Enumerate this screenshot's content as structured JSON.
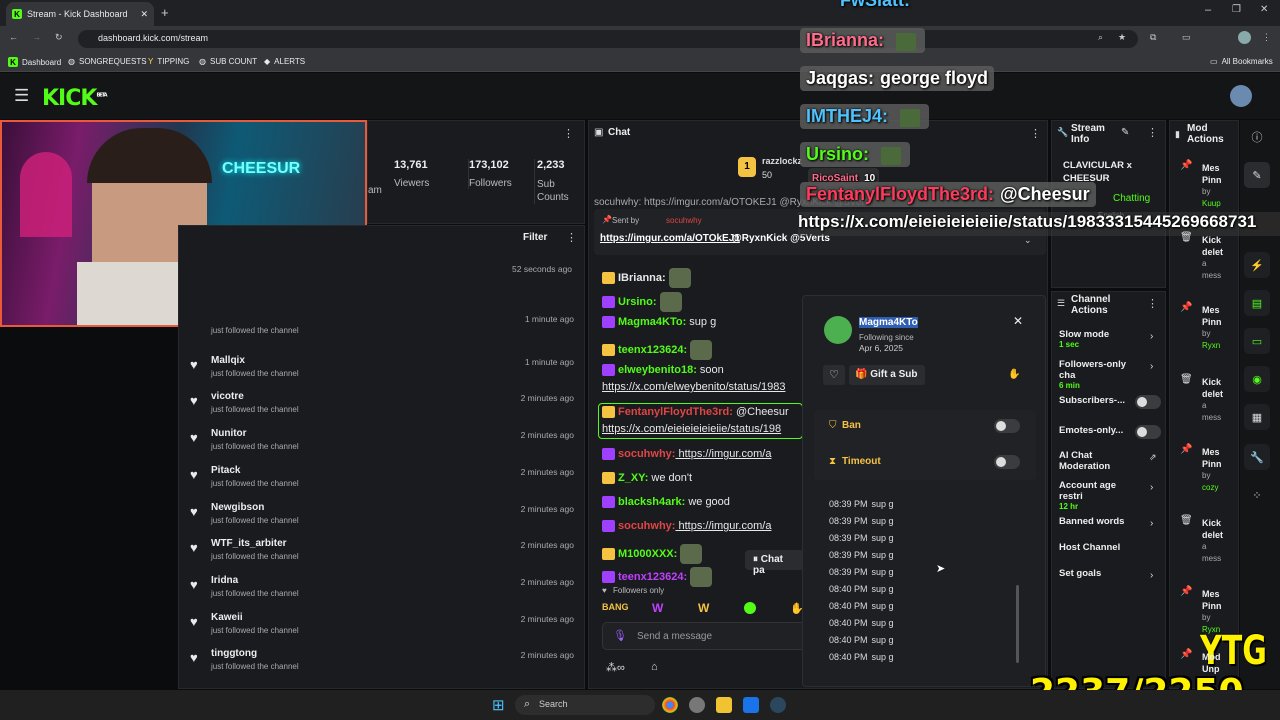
{
  "browser": {
    "tab_title": "Stream - Kick Dashboard",
    "url": "dashboard.kick.com/stream",
    "bookmarks": [
      "Dashboard",
      "SONGREQUESTS",
      "TIPPING",
      "SUB COUNT",
      "ALERTS"
    ],
    "all_bookmarks": "All Bookmarks"
  },
  "kick": {
    "logo": "KICK",
    "logo_tag": "BETA"
  },
  "stats": {
    "items": [
      {
        "value": "13,761",
        "label": "Viewers"
      },
      {
        "value": "173,102",
        "label": "Followers"
      },
      {
        "value": "2,233",
        "label": "Sub Counts"
      }
    ],
    "partial_label": "am"
  },
  "activity": {
    "filter": "Filter",
    "first_ago": "52 seconds ago",
    "items": [
      {
        "name": "",
        "sub": "just followed the channel",
        "ago": "1 minute ago"
      },
      {
        "name": "Mallqix",
        "sub": "just followed the channel",
        "ago": "1 minute ago"
      },
      {
        "name": "vicotre",
        "sub": "just followed the channel",
        "ago": "2 minutes ago"
      },
      {
        "name": "Nunitor",
        "sub": "just followed the channel",
        "ago": "2 minutes ago"
      },
      {
        "name": "Pitack",
        "sub": "just followed the channel",
        "ago": "2 minutes ago"
      },
      {
        "name": "Newgibson",
        "sub": "just followed the channel",
        "ago": "2 minutes ago"
      },
      {
        "name": "WTF_its_arbiter",
        "sub": "just followed the channel",
        "ago": "2 minutes ago"
      },
      {
        "name": "Iridna",
        "sub": "just followed the channel",
        "ago": "2 minutes ago"
      },
      {
        "name": "Kaweii",
        "sub": "just followed the channel",
        "ago": "2 minutes ago"
      },
      {
        "name": "tinggtong",
        "sub": "just followed the channel",
        "ago": "2 minutes ago"
      }
    ]
  },
  "chat": {
    "title": "Chat",
    "pinned_user": "razzlockz",
    "pinned_count": "50",
    "sender_line": "Sent by",
    "sender_name": "socuhwhy",
    "pinned_link": "https://imgur.com/a/OTOkEJ1",
    "pinned_mentions": " @RyxnKick @5Verts",
    "top_partial": "socuhwhy: https://imgur.com/a/OTOKEJ1 @RyxnKick @5Verts",
    "messages": [
      {
        "user": "IBrianna:",
        "text": ""
      },
      {
        "user": "Ursino:",
        "text": ""
      },
      {
        "user": "Magma4KTo:",
        "text": " sup g"
      },
      {
        "user": "teenx123624:",
        "text": ""
      },
      {
        "user": "elweybenito18:",
        "text": " soon"
      },
      {
        "user": "",
        "text": "https://x.com/elweybenito/status/1983"
      },
      {
        "user": "FentanylFloydThe3rd:",
        "text": " @Cheesur"
      },
      {
        "user": "",
        "text": "https://x.com/eieieieieieiie/status/198"
      },
      {
        "user": "socuhwhy:",
        "text": " https://imgur.com/a"
      },
      {
        "user": "Z_XY:",
        "text": " we don't"
      },
      {
        "user": "blacksh4ark:",
        "text": " we good"
      },
      {
        "user": "socuhwhy:",
        "text": " https://imgur.com/a"
      },
      {
        "user": "M1000XXX:",
        "text": ""
      },
      {
        "user": "teenx123624:",
        "text": ""
      }
    ],
    "followers_only": "Followers only",
    "paused": "Chat pa",
    "send_placeholder": "Send a message"
  },
  "usercard": {
    "name": "Magma4KTo",
    "following": "Following since",
    "date": "Apr 6, 2025",
    "gift": "Gift a Sub",
    "ban": "Ban",
    "timeout": "Timeout",
    "log": [
      {
        "time": "08:39 PM",
        "msg": "sup g"
      },
      {
        "time": "08:39 PM",
        "msg": "sup g"
      },
      {
        "time": "08:39 PM",
        "msg": "sup g"
      },
      {
        "time": "08:39 PM",
        "msg": "sup g"
      },
      {
        "time": "08:39 PM",
        "msg": "sup g"
      },
      {
        "time": "08:40 PM",
        "msg": "sup g"
      },
      {
        "time": "08:40 PM",
        "msg": "sup g"
      },
      {
        "time": "08:40 PM",
        "msg": "sup g"
      },
      {
        "time": "08:40 PM",
        "msg": "sup g"
      },
      {
        "time": "08:40 PM",
        "msg": "sup g"
      }
    ]
  },
  "streaminfo": {
    "title": "Stream Info",
    "stream_title": "CLAVICULAR x CHEESUR",
    "category": "Chatting",
    "language": "English"
  },
  "channel": {
    "title": "Channel Actions",
    "items": [
      {
        "label": "Slow mode",
        "sub": "1 sec"
      },
      {
        "label": "Followers-only cha",
        "sub": "6 min"
      },
      {
        "label": "Subscribers-...",
        "sub": ""
      },
      {
        "label": "Emotes-only...",
        "sub": ""
      },
      {
        "label": "AI Chat Moderation",
        "sub": ""
      },
      {
        "label": "Account age restri",
        "sub": "12 hr"
      },
      {
        "label": "Banned words",
        "sub": ""
      },
      {
        "label": "Host Channel",
        "sub": ""
      },
      {
        "label": "Set goals",
        "sub": ""
      }
    ]
  },
  "mod": {
    "title": "Mod Actions",
    "items": [
      {
        "line1": "Mes",
        "line2": "Pinn",
        "line3": "by",
        "line4": "Kuup"
      },
      {
        "line1": "Kick",
        "line2": "delet",
        "line3": "a",
        "line4": "mess"
      },
      {
        "line1": "Mes",
        "line2": "Pinn",
        "line3": "by",
        "line4": "Ryxn"
      },
      {
        "line1": "Kick",
        "line2": "delet",
        "line3": "a",
        "line4": "mess"
      },
      {
        "line1": "Mes",
        "line2": "Pinn",
        "line3": "by",
        "line4": "cozy"
      },
      {
        "line1": "Kick",
        "line2": "delet",
        "line3": "a",
        "line4": "mess"
      },
      {
        "line1": "Mes",
        "line2": "Pinn",
        "line3": "by",
        "line4": "Ryxn"
      },
      {
        "line1": "Mod",
        "line2": "Unp",
        "line3": "",
        "line4": ""
      }
    ]
  },
  "overlay": {
    "top_name": "FwSlatt:",
    "lines": [
      {
        "name": "IBrianna:",
        "text": ""
      },
      {
        "name": "Jaqgas:",
        "text": "george floyd"
      },
      {
        "name": "IMTHEJ4:",
        "text": ""
      },
      {
        "name": "Ursino:",
        "text": ""
      },
      {
        "name": "RicoSaint",
        "text": "10"
      },
      {
        "name": "FentanylFloydThe3rd:",
        "text": "@Cheesur"
      }
    ],
    "link": "https://x.com/eieieieieieiie/status/19833315445269668731",
    "brand": "YTG",
    "counter": "2237/2250"
  },
  "taskbar": {
    "search": "Search"
  }
}
